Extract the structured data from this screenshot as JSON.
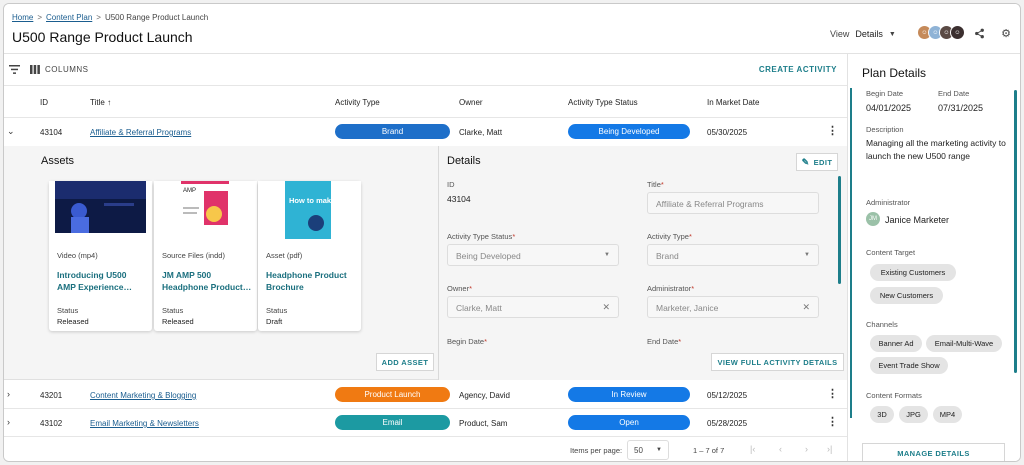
{
  "breadcrumb": {
    "home": "Home",
    "content_plan": "Content Plan",
    "current": "U500 Range Product Launch",
    "sep": ">"
  },
  "page_title": "U500 Range Product Launch",
  "view": {
    "label": "View",
    "value": "Details"
  },
  "toolbar": {
    "columns": "COLUMNS",
    "create": "CREATE ACTIVITY"
  },
  "table": {
    "headers": {
      "id": "ID",
      "title": "Title",
      "activity_type": "Activity Type",
      "owner": "Owner",
      "status": "Activity Type Status",
      "market_date": "In Market Date",
      "sort_arrow": "↑"
    },
    "rows": [
      {
        "id": "43104",
        "title": "Affiliate & Referral Programs",
        "type": "Brand",
        "type_color": "#1e6fc9",
        "owner": "Clarke, Matt",
        "status": "Being Developed",
        "date": "05/30/2025"
      },
      {
        "id": "43201",
        "title": "Content Marketing & Blogging",
        "type": "Product Launch",
        "type_color": "#f07a12",
        "owner": "Agency, David",
        "status": "In Review",
        "date": "05/12/2025"
      },
      {
        "id": "43102",
        "title": "Email Marketing & Newsletters",
        "type": "Email",
        "type_color": "#1c9aa2",
        "owner": "Product, Sam",
        "status": "Open",
        "date": "05/28/2025"
      }
    ]
  },
  "assets": {
    "title": "Assets",
    "cards": [
      {
        "type": "Video (mp4)",
        "name1": "Introducing U500",
        "name2": "AMP Experience…",
        "status_label": "Status",
        "status": "Released"
      },
      {
        "type": "Source Files (indd)",
        "name1": "JM AMP 500",
        "name2": "Headphone Product…",
        "status_label": "Status",
        "status": "Released"
      },
      {
        "type": "Asset (pdf)",
        "name1": "Headphone Product",
        "name2": "Brochure",
        "status_label": "Status",
        "status": "Draft"
      }
    ],
    "add_button": "ADD ASSET",
    "thumb_text": {
      "amp": "AMP",
      "poster": "How to make it hello"
    }
  },
  "details": {
    "title": "Details",
    "edit": "EDIT",
    "id_label": "ID",
    "id_value": "43104",
    "title_label": "Title",
    "title_value": "Affiliate & Referral Programs",
    "status_label": "Activity Type Status",
    "status_value": "Being Developed",
    "type_label": "Activity Type",
    "type_value": "Brand",
    "owner_label": "Owner",
    "owner_value": "Clarke, Matt",
    "admin_label": "Administrator",
    "admin_value": "Marketer, Janice",
    "begin_label": "Begin Date",
    "end_label": "End Date",
    "req": "*",
    "view_full": "VIEW FULL ACTIVITY DETAILS"
  },
  "pager": {
    "items_label": "Items per page:",
    "per_page": "50",
    "range": "1 – 7 of 7"
  },
  "plan": {
    "title": "Plan Details",
    "begin_label": "Begin Date",
    "begin": "04/01/2025",
    "end_label": "End Date",
    "end": "07/31/2025",
    "desc_label": "Description",
    "desc": "Managing all the marketing activity to launch the new U500 range",
    "admin_label": "Administrator",
    "admin": "Janice Marketer",
    "admin_initials": "JM",
    "target_label": "Content Target",
    "targets": [
      "Existing Customers",
      "New Customers"
    ],
    "channels_label": "Channels",
    "channels": [
      "Banner Ad",
      "Email-Multi-Wave",
      "Event Trade Show"
    ],
    "formats_label": "Content Formats",
    "formats": [
      "3D",
      "JPG",
      "MP4"
    ],
    "manage": "MANAGE DETAILS"
  },
  "colors": {
    "accent": "#1d7e8a",
    "status_blue": "#1479e6"
  }
}
